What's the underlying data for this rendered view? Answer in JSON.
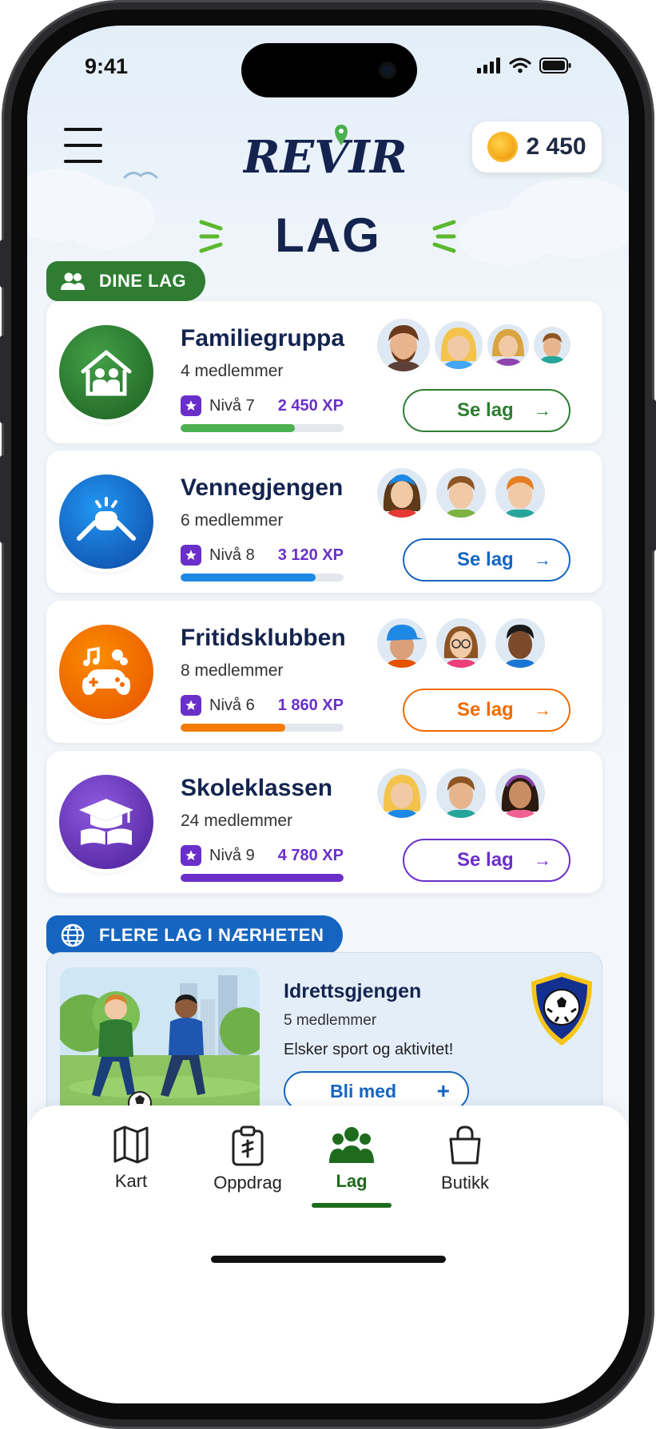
{
  "status_bar": {
    "time": "9:41"
  },
  "header": {
    "logo_text": "REVIR",
    "coins": "2 450"
  },
  "page": {
    "title": "LAG"
  },
  "colors": {
    "brand_navy": "#14244f",
    "green": "#2e7d32",
    "blue": "#1565c0",
    "orange": "#ef6c00",
    "purple": "#6a2fc9"
  },
  "my_teams": {
    "section_label": "DINE LAG",
    "section_icon": "people-icon",
    "teams": [
      {
        "name": "Familiegruppa",
        "members": "4 medlemmer",
        "level": "Nivå 7",
        "xp": "2 450 XP",
        "progress": 0.7,
        "button": "Se lag",
        "icon": "house-family-icon",
        "color": "#2e7d32"
      },
      {
        "name": "Vennegjengen",
        "members": "6 medlemmer",
        "level": "Nivå 8",
        "xp": "3 120 XP",
        "progress": 0.83,
        "button": "Se lag",
        "icon": "fist-bump-icon",
        "color": "#1565c0"
      },
      {
        "name": "Fritidsklubben",
        "members": "8 medlemmer",
        "level": "Nivå 6",
        "xp": "1 860 XP",
        "progress": 0.64,
        "button": "Se lag",
        "icon": "gamepad-music-icon",
        "color": "#ef6c00"
      },
      {
        "name": "Skoleklassen",
        "members": "24 medlemmer",
        "level": "Nivå 9",
        "xp": "4 780 XP",
        "progress": 1.0,
        "button": "Se lag",
        "icon": "graduation-cap-icon",
        "color": "#6a2fc9"
      }
    ]
  },
  "nearby": {
    "section_label": "FLERE LAG I NÆRHETEN",
    "section_icon": "globe-icon",
    "team": {
      "name": "Idrettsgjengen",
      "members": "5 medlemmer",
      "description": "Elsker sport og aktivitet!",
      "button": "Bli med",
      "button_icon": "+"
    }
  },
  "bottom_nav": {
    "items": [
      {
        "label": "Kart",
        "icon": "map-icon",
        "active": false
      },
      {
        "label": "Oppdrag",
        "icon": "clipboard-icon",
        "active": false
      },
      {
        "label": "Lag",
        "icon": "people-icon",
        "active": true
      },
      {
        "label": "Butikk",
        "icon": "shopping-bag-icon",
        "active": false
      }
    ]
  }
}
